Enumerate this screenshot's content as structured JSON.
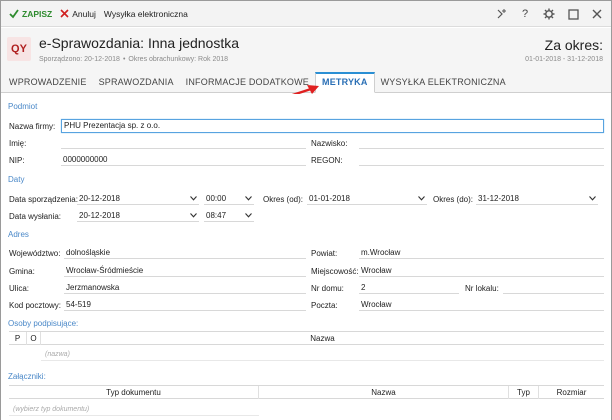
{
  "toolbar": {
    "save_label": "ZAPISZ",
    "cancel_label": "Anuluj",
    "send_label": "Wysyłka elektroniczna",
    "help_label": "?"
  },
  "header": {
    "logo": "QY",
    "title": "e-Sprawozdania: Inna jednostka",
    "created": "Sporządzono: 20-12-2018",
    "period_sub": "Okres obrachunkowy: Rok 2018",
    "period_label": "Za okres:",
    "period_range": "01-01-2018 - 31-12-2018"
  },
  "tabs": [
    {
      "label": "WPROWADZENIE"
    },
    {
      "label": "SPRAWOZDANIA"
    },
    {
      "label": "INFORMACJE DODATKOWE"
    },
    {
      "label": "METRYKA",
      "active": true
    },
    {
      "label": "WYSYŁKA ELEKTRONICZNA"
    }
  ],
  "podmiot": {
    "section": "Podmiot",
    "firm_label": "Nazwa firmy:",
    "firm_value": "PHU Prezentacja sp. z o.o.",
    "first_name_label": "Imię:",
    "first_name_value": "",
    "last_name_label": "Nazwisko:",
    "last_name_value": "",
    "nip_label": "NIP:",
    "nip_value": "0000000000",
    "regon_label": "REGON:",
    "regon_value": ""
  },
  "daty": {
    "section": "Daty",
    "prep_label": "Data sporządzenia:",
    "prep_date": "20-12-2018",
    "prep_time": "00:00",
    "from_label": "Okres (od):",
    "from_value": "01-01-2018",
    "to_label": "Okres (do):",
    "to_value": "31-12-2018",
    "send_label": "Data wysłania:",
    "send_date": "20-12-2018",
    "send_time": "08:47"
  },
  "adres": {
    "section": "Adres",
    "woj_label": "Województwo:",
    "woj_value": "dolnośląskie",
    "powiat_label": "Powiat:",
    "powiat_value": "m.Wrocław",
    "gmina_label": "Gmina:",
    "gmina_value": "Wrocław-Śródmieście",
    "miejsc_label": "Miejscowość:",
    "miejsc_value": "Wrocław",
    "ulica_label": "Ulica:",
    "ulica_value": "Jerzmanowska",
    "nrdomu_label": "Nr domu:",
    "nrdomu_value": "2",
    "nrlokalu_label": "Nr lokalu:",
    "nrlokalu_value": "",
    "kod_label": "Kod pocztowy:",
    "kod_value": "54-519",
    "poczta_label": "Poczta:",
    "poczta_value": "Wrocław"
  },
  "osoby": {
    "section": "Osoby podpisujące:",
    "col_p": "P",
    "col_o": "O",
    "col_name": "Nazwa",
    "placeholder": "(nazwa)"
  },
  "zalaczniki": {
    "section": "Załączniki:",
    "col_type": "Typ dokumentu",
    "col_name": "Nazwa",
    "col_typ": "Typ",
    "col_size": "Rozmiar",
    "placeholder": "(wybierz typ dokumentu)"
  },
  "colors": {
    "accent": "#2a6fb5",
    "section": "#4a88c8",
    "save": "#2e8b2e",
    "cancel": "#d02020",
    "arrow": "#e02020"
  }
}
